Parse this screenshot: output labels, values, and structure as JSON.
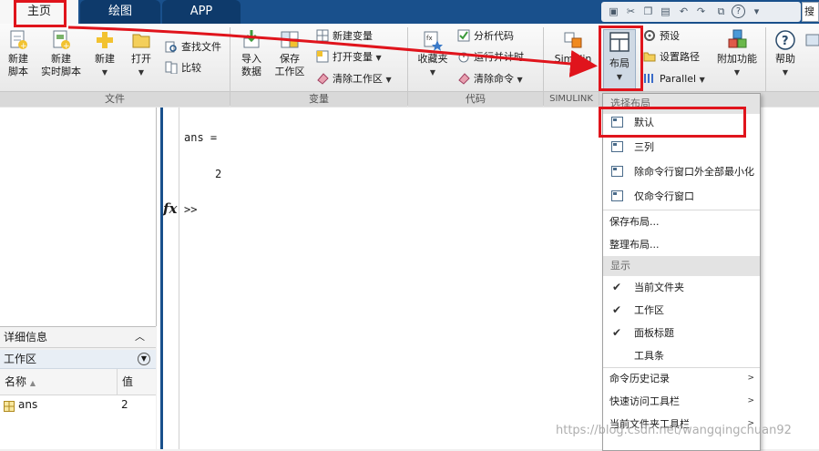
{
  "tabs": [
    {
      "label": "主页",
      "active": true
    },
    {
      "label": "绘图",
      "active": false
    },
    {
      "label": "APP",
      "active": false
    }
  ],
  "search": {
    "label": "搜"
  },
  "ribbon": {
    "file_group": {
      "label": "文件",
      "new_script": "新建\n脚本",
      "new_live_script": "新建\n实时脚本",
      "new": "新建",
      "open": "打开",
      "find_files": "查找文件",
      "compare": "比较"
    },
    "variable_group": {
      "label": "变量",
      "import_data": "导入\n数据",
      "save_workspace": "保存\n工作区",
      "new_variable": "新建变量",
      "open_variable": "打开变量",
      "clear_workspace": "清除工作区"
    },
    "code_group": {
      "label": "代码",
      "favorites": "收藏夹",
      "analyze_code": "分析代码",
      "run_and_time": "运行并计时",
      "clear_commands": "清除命令"
    },
    "simulink_group": {
      "label": "SIMULINK",
      "simulink": "Simulin"
    },
    "environment_group": {
      "layout": "布局",
      "preferences": "预设",
      "set_path": "设置路径",
      "parallel": "Parallel",
      "addons": "附加功能"
    },
    "resources_group": {
      "help": "帮助"
    }
  },
  "command_window": {
    "line1": "ans =",
    "line2": "2",
    "prompt_fx": "fx",
    "prompt": ">>"
  },
  "panels": {
    "details": "详细信息",
    "workspace": "工作区",
    "columns": [
      "名称",
      "值"
    ],
    "rows": [
      {
        "name": "ans",
        "value": "2"
      }
    ]
  },
  "layout_menu": {
    "header_select": "选择布局",
    "layouts": [
      "默认",
      "三列",
      "除命令行窗口外全部最小化",
      "仅命令行窗口"
    ],
    "save_layout": "保存布局...",
    "organize_layout": "整理布局...",
    "header_show": "显示",
    "show_items": [
      {
        "label": "当前文件夹",
        "checked": true
      },
      {
        "label": "工作区",
        "checked": true
      },
      {
        "label": "面板标题",
        "checked": true
      },
      {
        "label": "工具条",
        "checked": false
      }
    ],
    "submenus": [
      "命令历史记录",
      "快速访问工具栏",
      "当前文件夹工具栏"
    ]
  },
  "watermark": "https://blog.csdn.net/wangqingchuan92",
  "colors": {
    "accent": "#19508c",
    "annotation": "#e0141c"
  }
}
